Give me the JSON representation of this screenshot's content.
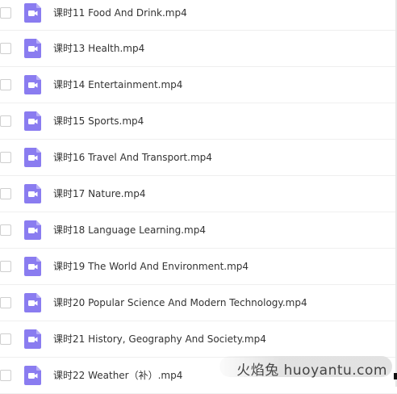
{
  "files": [
    {
      "name": "课时11 Food And Drink.mp4",
      "icon": "video-file-icon"
    },
    {
      "name": "课时13 Health.mp4",
      "icon": "video-file-icon"
    },
    {
      "name": "课时14 Entertainment.mp4",
      "icon": "video-file-icon"
    },
    {
      "name": "课时15 Sports.mp4",
      "icon": "video-file-icon"
    },
    {
      "name": "课时16 Travel And Transport.mp4",
      "icon": "video-file-icon"
    },
    {
      "name": "课时17 Nature.mp4",
      "icon": "video-file-icon"
    },
    {
      "name": "课时18 Language Learning.mp4",
      "icon": "video-file-icon"
    },
    {
      "name": "课时19 The World And Environment.mp4",
      "icon": "video-file-icon"
    },
    {
      "name": "课时20 Popular Science And Modern Technology.mp4",
      "icon": "video-file-icon"
    },
    {
      "name": "课时21 History, Geography And Society.mp4",
      "icon": "video-file-icon"
    },
    {
      "name": "课时22 Weather（补）.mp4",
      "icon": "video-file-icon"
    }
  ],
  "watermark": {
    "text": "火焰兔 huoyantu.com"
  },
  "colors": {
    "icon_fill": "#8a7cf0",
    "text": "#333333",
    "row_border": "#efefef"
  }
}
